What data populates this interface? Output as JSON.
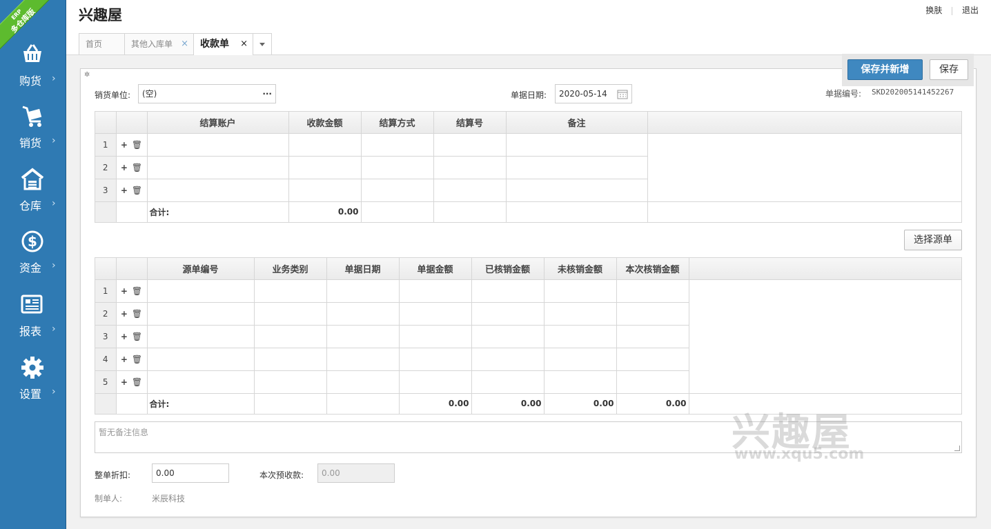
{
  "sidebar": {
    "ribbon_small": "ERP",
    "ribbon_big": "多仓库版",
    "items": [
      {
        "label": "购货",
        "icon": "basket-icon"
      },
      {
        "label": "销货",
        "icon": "cart-icon"
      },
      {
        "label": "仓库",
        "icon": "warehouse-icon"
      },
      {
        "label": "资金",
        "icon": "dollar-icon"
      },
      {
        "label": "报表",
        "icon": "report-icon"
      },
      {
        "label": "设置",
        "icon": "gear-icon"
      }
    ],
    "chevron": "›"
  },
  "header": {
    "title": "兴趣屋",
    "links": {
      "skin": "换肤",
      "logout": "退出"
    }
  },
  "tabs": [
    {
      "label": "首页",
      "closable": false
    },
    {
      "label": "其他入库单",
      "closable": true
    },
    {
      "label": "收款单",
      "closable": true,
      "active": true
    }
  ],
  "toolbar": {
    "save_new": "保存并新增",
    "save": "保存"
  },
  "form": {
    "customer_label": "销货单位:",
    "customer_value": "(空)",
    "customer_more": "···",
    "date_label": "单据日期:",
    "date_value": "2020-05-14",
    "docno_label": "单据编号:",
    "docno_value": "SKD202005141452267"
  },
  "grid1": {
    "headers": [
      "结算账户",
      "收款金额",
      "结算方式",
      "结算号",
      "备注"
    ],
    "rows": [
      "1",
      "2",
      "3"
    ],
    "total_label": "合计:",
    "total_amount": "0.00"
  },
  "pick_source": "选择源单",
  "grid2": {
    "headers": [
      "源单编号",
      "业务类别",
      "单据日期",
      "单据金额",
      "已核销金额",
      "未核销金额",
      "本次核销金额"
    ],
    "rows": [
      "1",
      "2",
      "3",
      "4",
      "5"
    ],
    "total_label": "合计:",
    "totals": [
      "0.00",
      "0.00",
      "0.00",
      "0.00"
    ]
  },
  "remark_placeholder": "暂无备注信息",
  "footer": {
    "discount_label": "整单折扣:",
    "discount_value": "0.00",
    "prepay_label": "本次预收款:",
    "prepay_value": "0.00",
    "maker_label": "制单人:",
    "maker_value": "米辰科技"
  },
  "watermark": {
    "big": "兴趣屋",
    "small": "www.xqu5.com"
  },
  "colors": {
    "sidebar": "#2f7ab3",
    "primary_button": "#3f88c0",
    "ribbon": "#5dbb2e"
  }
}
